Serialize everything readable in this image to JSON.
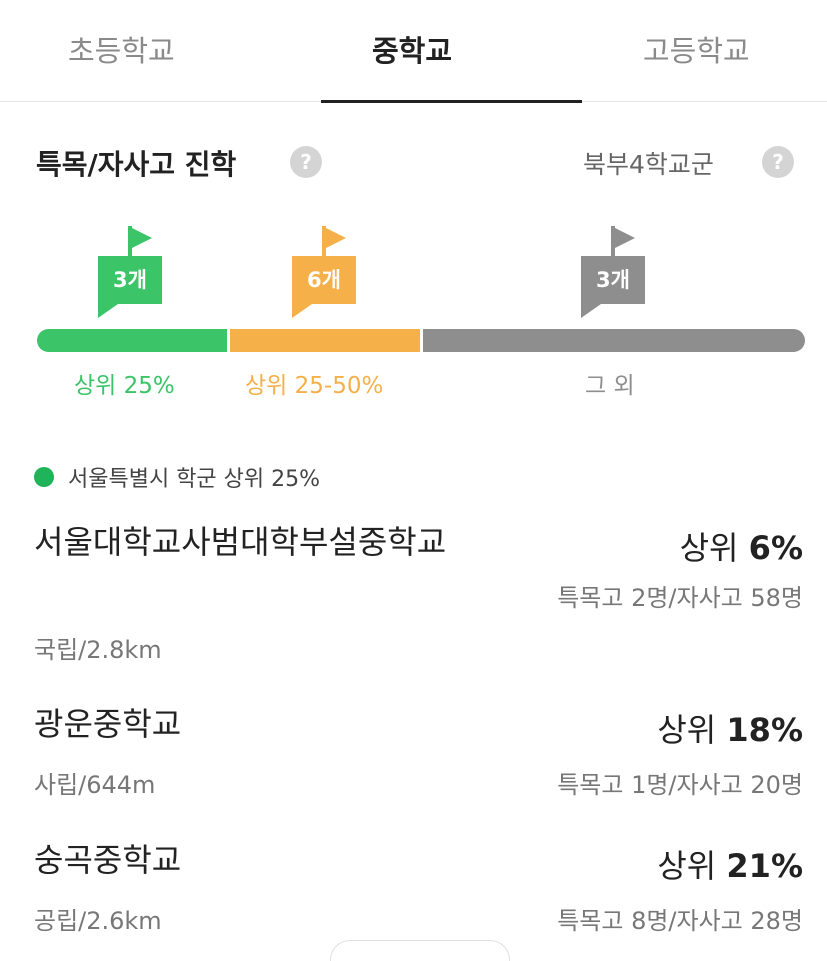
{
  "tabs": [
    "초등학교",
    "중학교",
    "고등학교"
  ],
  "section": {
    "title": "특목/자사고 진학",
    "region": "북부4학교군"
  },
  "colors": {
    "green": "#3cc468",
    "orange": "#f5b04a",
    "gray": "#8e8e8e",
    "legend_dot": "#1fb35a"
  },
  "distribution": {
    "flags": [
      "3개",
      "6개",
      "3개"
    ],
    "labels": [
      "상위 25%",
      "상위 25-50%",
      "그 외"
    ]
  },
  "legend": "서울특별시 학군 상위 25%",
  "schools": [
    {
      "name": "서울대학교사범대학부설중학교",
      "meta": "국립/2.8km",
      "rank_prefix": "상위 ",
      "rank_value": "6%",
      "stats": "특목고 2명/자사고 58명"
    },
    {
      "name": "광운중학교",
      "meta": "사립/644m",
      "rank_prefix": "상위 ",
      "rank_value": "18%",
      "stats": "특목고 1명/자사고 20명"
    },
    {
      "name": "숭곡중학교",
      "meta": "공립/2.6km",
      "rank_prefix": "상위 ",
      "rank_value": "21%",
      "stats": "특목고 8명/자사고 28명"
    }
  ]
}
